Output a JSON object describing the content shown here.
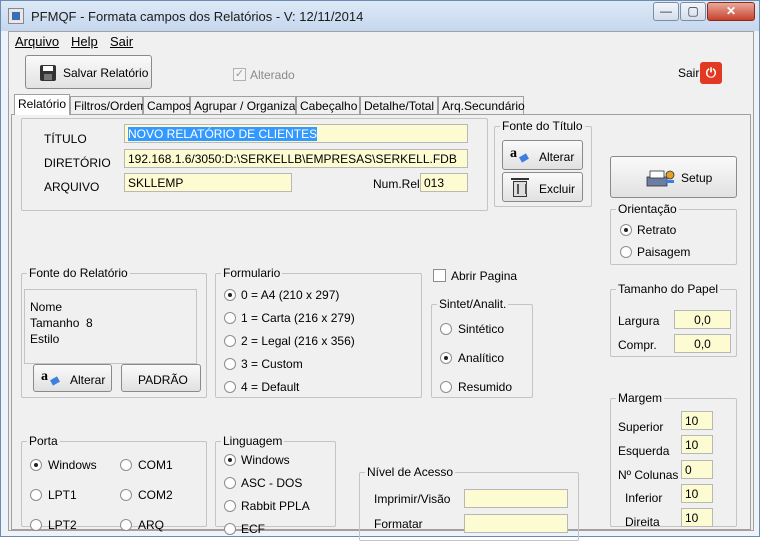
{
  "window": {
    "title": "PFMQF - Formata campos dos Relatórios - V: 12/11/2014"
  },
  "menu": [
    "Arquivo",
    "Help",
    "Sair"
  ],
  "toolbar": {
    "save_label": "Salvar Relatório",
    "alterado_label": "Alterado",
    "alterado_checked": true,
    "sair_label": "Sair"
  },
  "tabs": [
    "Relatório",
    "Filtros/Ordem",
    "Campos",
    "Agrupar / Organizar",
    "Cabeçalho",
    "Detalhe/Total",
    "Arq.Secundário"
  ],
  "form": {
    "titulo_label": "TÍTULO",
    "titulo_value": "NOVO RELATÓRIO DE CLIENTES",
    "diretorio_label": "DIRETÓRIO",
    "diretorio_value": "192.168.1.6/3050:D:\\SERKELLB\\EMPRESAS\\SERKELL.FDB",
    "arquivo_label": "ARQUIVO",
    "arquivo_value": "SKLLEMP",
    "numrel_label": "Num.Rel.",
    "numrel_value": "013"
  },
  "fonte_titulo": {
    "title": "Fonte do Título",
    "alterar": "Alterar",
    "excluir": "Excluir"
  },
  "setup": {
    "label": "Setup"
  },
  "orientacao": {
    "title": "Orientação",
    "options": [
      "Retrato",
      "Paisagem"
    ],
    "selected": 0
  },
  "tamanho_papel": {
    "title": "Tamanho do Papel",
    "largura_label": "Largura",
    "largura_value": "0,0",
    "compr_label": "Compr.",
    "compr_value": "0,0"
  },
  "fonte_relatorio": {
    "title": "Fonte do Relatório",
    "nome_label": "Nome",
    "tamanho_label": "Tamanho",
    "tamanho_value": "8",
    "estilo_label": "Estilo",
    "alterar": "Alterar",
    "padrao": "PADRÃO"
  },
  "formulario": {
    "title": "Formulario",
    "options": [
      "0 = A4 (210 x 297)",
      "1 = Carta (216 x 279)",
      "2 = Legal (216 x 356)",
      "3 = Custom",
      "4 = Default"
    ],
    "selected": 0
  },
  "abrir_pagina": {
    "label": "Abrir Pagina",
    "checked": false
  },
  "sintet": {
    "title": "Sintet/Analit.",
    "options": [
      "Sintético",
      "Analítico",
      "Resumido"
    ],
    "selected": 1
  },
  "margem": {
    "title": "Margem",
    "items": [
      {
        "label": "Superior",
        "value": "10"
      },
      {
        "label": "Esquerda",
        "value": "10"
      },
      {
        "label": "Nº Colunas",
        "value": "0"
      },
      {
        "label": "Inferior",
        "value": "10"
      },
      {
        "label": "Direita",
        "value": "10"
      }
    ]
  },
  "porta": {
    "title": "Porta",
    "options": [
      "Windows",
      "COM1",
      "LPT1",
      "COM2",
      "LPT2",
      "ARQ"
    ],
    "selected": 0
  },
  "linguagem": {
    "title": "Linguagem",
    "options": [
      "Windows",
      "ASC - DOS",
      "Rabbit PPLA",
      "ECF"
    ],
    "selected": 0
  },
  "nivel_acesso": {
    "title": "Nível de Acesso",
    "imprimir_label": "Imprimir/Visão",
    "imprimir_value": "",
    "formatar_label": "Formatar",
    "formatar_value": ""
  },
  "colors": {
    "field_bg": "#fcfbd2",
    "selection": "#3399ff",
    "close_red": "#c7432e",
    "sair_red": "#e23a22"
  }
}
